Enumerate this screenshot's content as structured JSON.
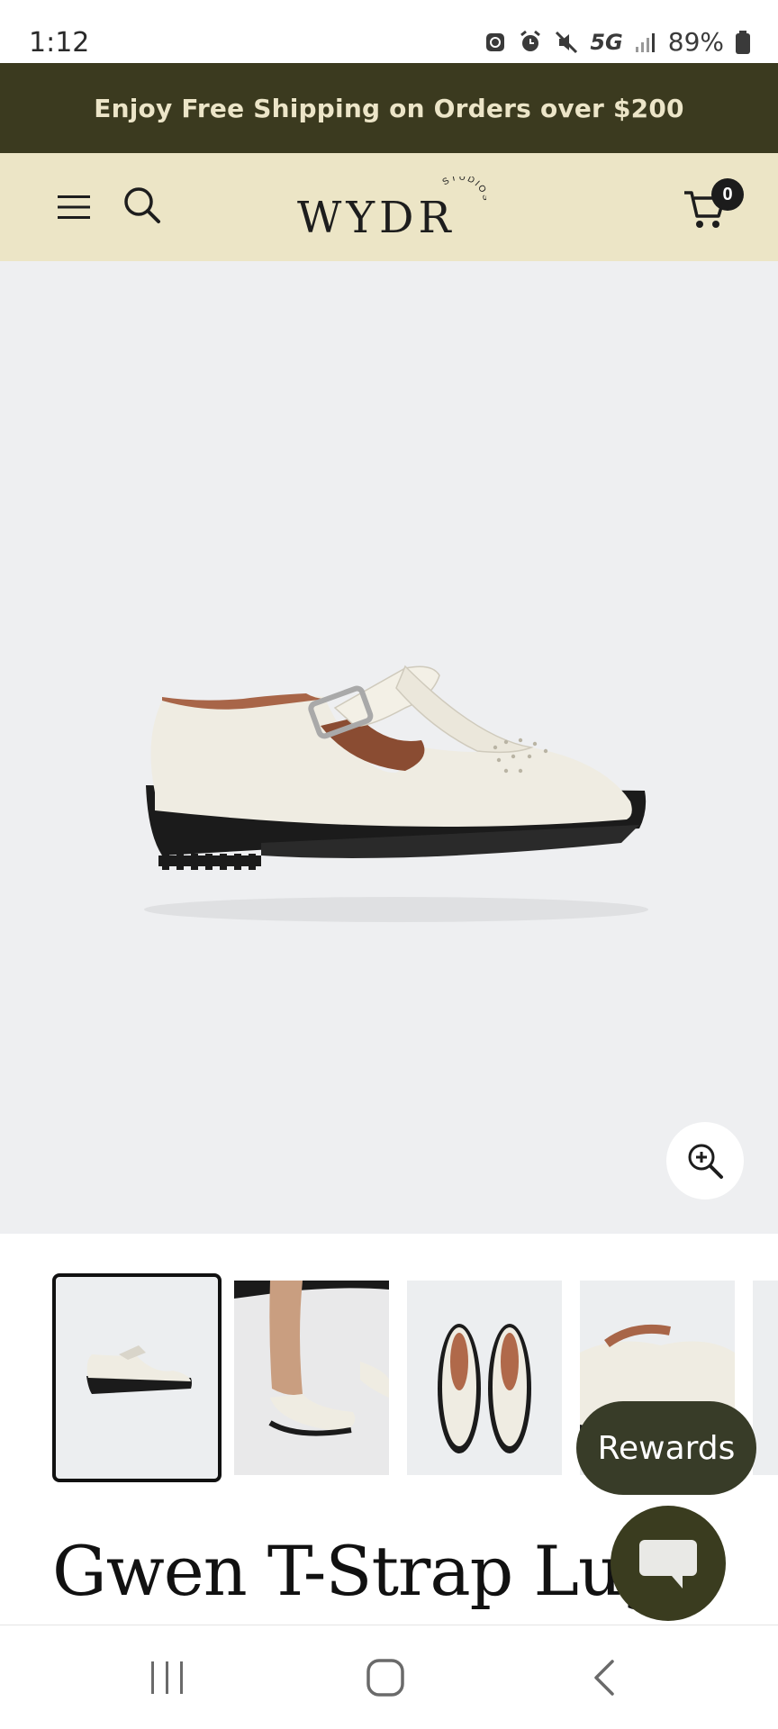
{
  "status_bar": {
    "time": "1:12",
    "network": "5G",
    "battery": "89%"
  },
  "announcement": {
    "text": "Enjoy Free Shipping on Orders over $200"
  },
  "header": {
    "logo": "WYDR",
    "logo_sub": "STUDIOS",
    "cart_count": "0"
  },
  "product": {
    "title": "Gwen T-Strap Lug",
    "thumbnail_count": 5,
    "active_thumbnail": 1
  },
  "floating": {
    "rewards_label": "Rewards"
  },
  "colors": {
    "announcement_bg": "#3b3a1f",
    "header_bg": "#ece5c6",
    "rewards_bg": "#383c28"
  }
}
